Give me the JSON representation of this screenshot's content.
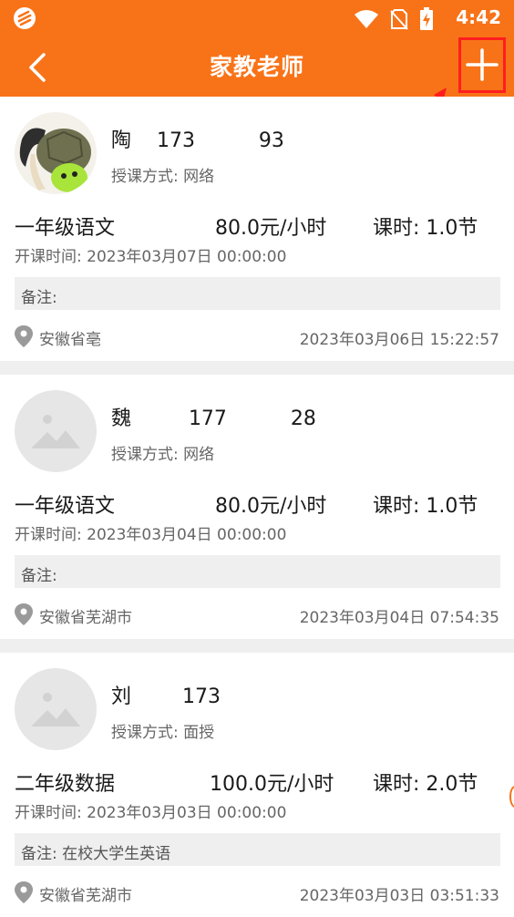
{
  "status_bar": {
    "time": "4:42"
  },
  "toolbar": {
    "title": "家教老师"
  },
  "colors": {
    "brand": "#f87318",
    "annotation": "#ff1e1e"
  },
  "posts": [
    {
      "name_line": "陶    173          93",
      "teaching_mode": "授课方式: 网络",
      "subject": "一年级语文",
      "price": "80.0元/小时",
      "lesson_hours": "课时: 1.0节",
      "start_time": "开课时间: 2023年03月07日 00:00:00",
      "note": "备注:",
      "address": "安徽省亳",
      "posted_at": "2023年03月06日 15:22:57",
      "avatar_icon": "turtle-cartoon-avatar"
    },
    {
      "name_line": "魏         177          28",
      "teaching_mode": "授课方式: 网络",
      "subject": "一年级语文",
      "price": "80.0元/小时",
      "lesson_hours": "课时: 1.0节",
      "start_time": "开课时间: 2023年03月04日 00:00:00",
      "note": "备注:",
      "address": "安徽省芜湖市",
      "posted_at": "2023年03月04日 07:54:35",
      "avatar_icon": "image-placeholder-icon"
    },
    {
      "name_line": "刘        173",
      "teaching_mode": "授课方式: 面授",
      "subject": "二年级数据",
      "price": "100.0元/小时",
      "lesson_hours": "课时: 2.0节",
      "start_time": "开课时间: 2023年03月03日 00:00:00",
      "note": "备注: 在校大学生英语",
      "address": "安徽省芜湖市",
      "posted_at": "2023年03月03日 03:51:33",
      "avatar_icon": "image-placeholder-icon"
    }
  ]
}
